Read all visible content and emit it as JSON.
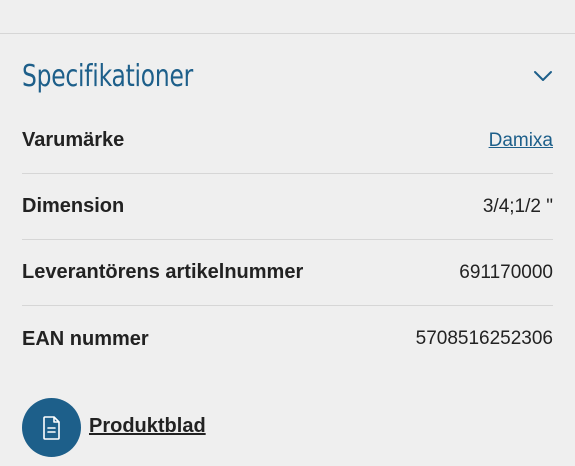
{
  "section": {
    "title": "Specifikationer",
    "toggle_icon": "chevron-down-icon",
    "accent_color": "#1d5f8a"
  },
  "specs": [
    {
      "label": "Varumärke",
      "value": "Damixa",
      "is_link": true
    },
    {
      "label": "Dimension",
      "value": "3/4;1/2 \"",
      "is_link": false
    },
    {
      "label": "Leverantörens artikelnummer",
      "value": "691170000",
      "is_link": false
    },
    {
      "label": "EAN nummer",
      "value": "5708516252306",
      "is_link": false
    }
  ],
  "document": {
    "label": "Produktblad",
    "icon": "document-icon"
  }
}
